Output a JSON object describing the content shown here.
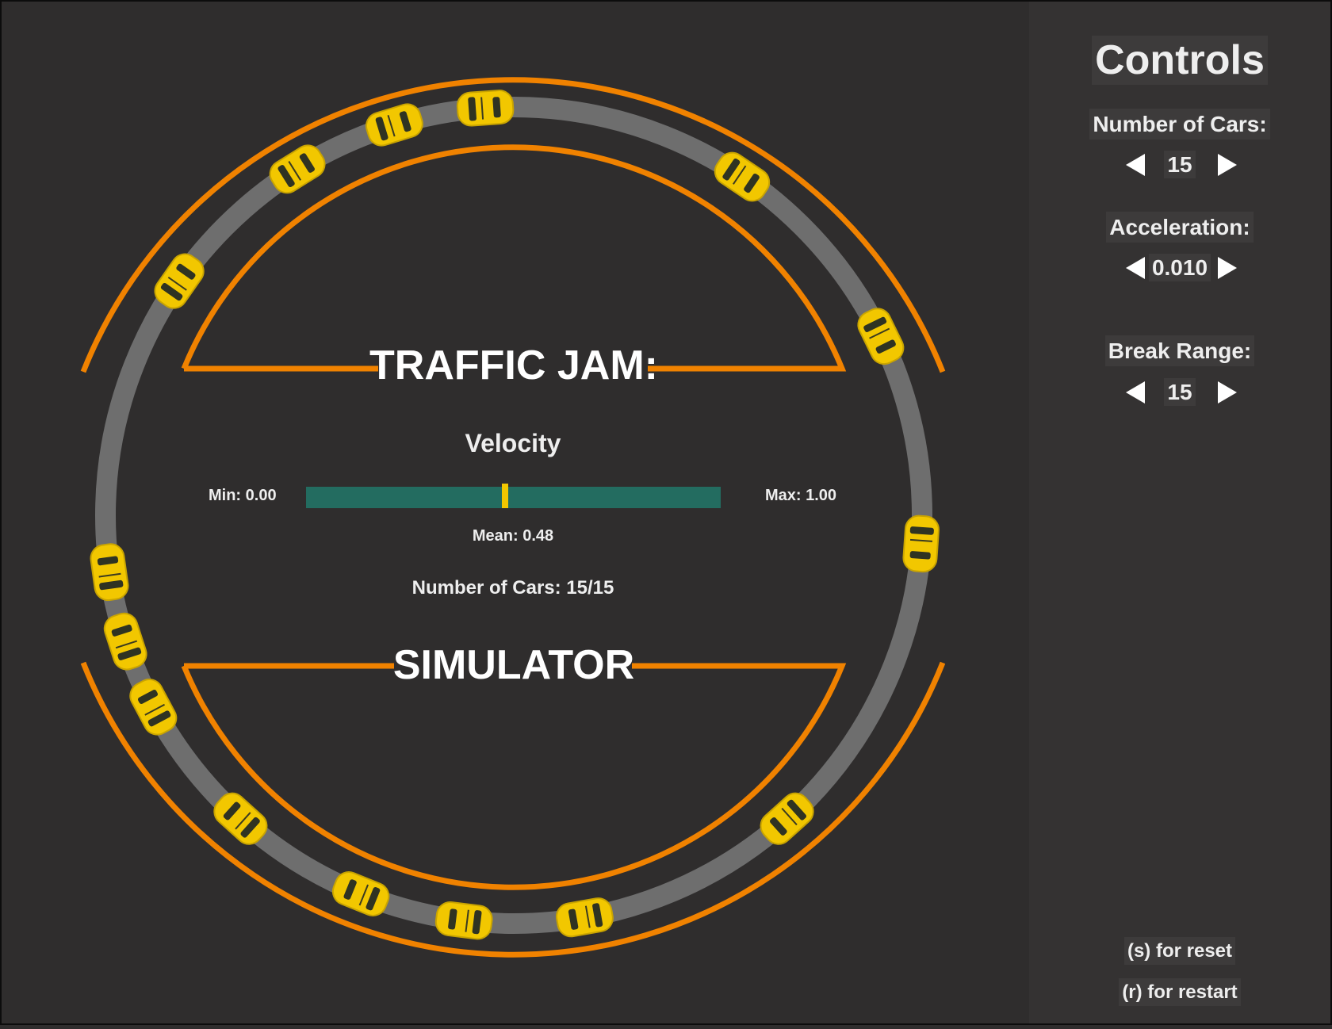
{
  "game": {
    "title_top": "TRAFFIC JAM:",
    "title_bottom": "SIMULATOR",
    "velocity_label": "Velocity",
    "min_label": "Min: 0.00",
    "max_label": "Max: 1.00",
    "mean_label": "Mean: 0.48",
    "mean_value": 0.48,
    "cars_label": "Number of Cars: 15/15",
    "cars": [
      {
        "angle": -94
      },
      {
        "angle": -107
      },
      {
        "angle": -122
      },
      {
        "angle": -56
      },
      {
        "angle": -145
      },
      {
        "angle": -26
      },
      {
        "angle": 172
      },
      {
        "angle": 4
      },
      {
        "angle": 162
      },
      {
        "angle": 152
      },
      {
        "angle": 132
      },
      {
        "angle": 48
      },
      {
        "angle": 112
      },
      {
        "angle": 97
      },
      {
        "angle": 80
      }
    ]
  },
  "colors": {
    "background": "#2f2d2d",
    "panel": "#343232",
    "road": "#6e6e6e",
    "barrier": "#f08200",
    "car": "#f2c700",
    "gauge_bar": "#236c60",
    "gauge_marker": "#f2c700"
  },
  "controls": {
    "title": "Controls",
    "cars_label": "Number of Cars:",
    "cars_value": "15",
    "accel_label": "Acceleration:",
    "accel_value": "0.010",
    "break_label": "Break Range:",
    "break_value": "15",
    "reset_hint": "(s) for reset",
    "restart_hint": "(r) for restart"
  }
}
